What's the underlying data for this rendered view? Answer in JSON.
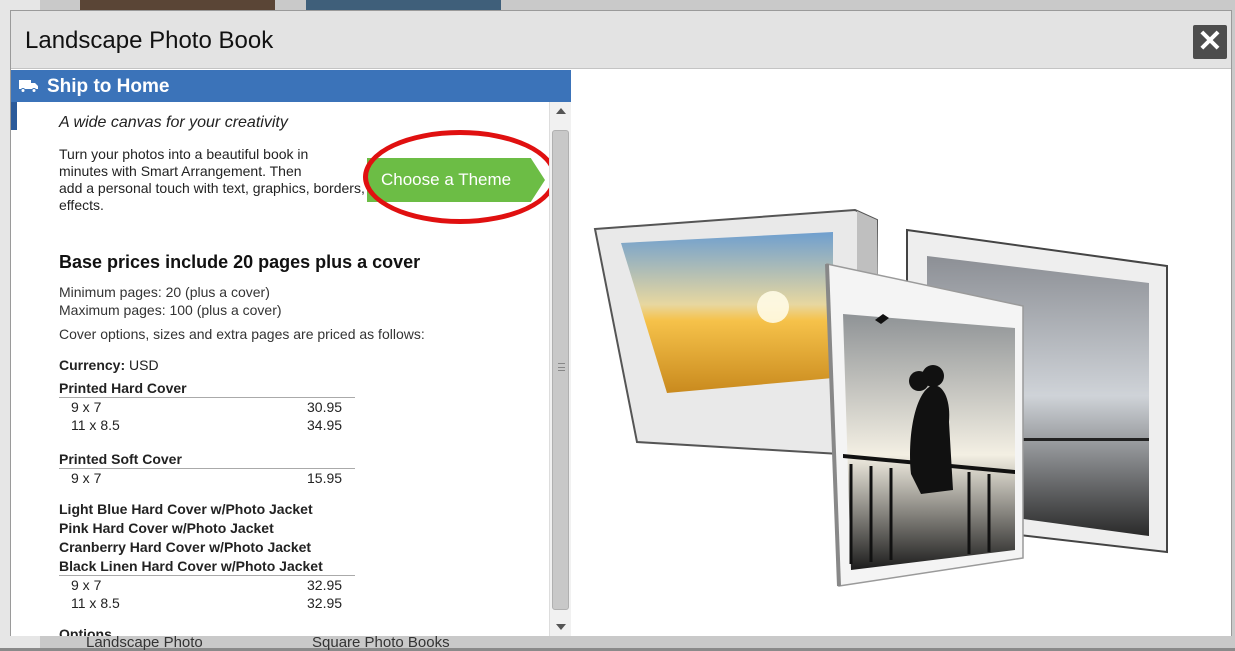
{
  "background": {
    "label_left": "Landscape Photo",
    "label_right": "Square Photo Books",
    "watermark": "book"
  },
  "dialog": {
    "title": "Landscape Photo Book",
    "close_icon": "close-icon"
  },
  "ship": {
    "icon": "truck-icon",
    "label": "Ship to Home"
  },
  "product": {
    "tagline": "A wide canvas for your creativity",
    "desc_line1": "Turn your photos into a beautiful book in",
    "desc_line2": "minutes with Smart Arrangement. Then",
    "desc_line3": "add a personal touch with text, graphics, borders, and tinting",
    "desc_line4": "effects.",
    "choose_theme": "Choose a Theme",
    "heading": "Base prices include 20 pages plus a cover",
    "min_pages": "Minimum pages: 20 (plus a cover)",
    "max_pages": "Maximum pages: 100 (plus a cover)",
    "cover_options": "Cover options, sizes and extra pages are priced as follows:",
    "currency_label": "Currency:",
    "currency_value": "USD",
    "groups": {
      "hard": {
        "title": "Printed Hard Cover",
        "rows": [
          {
            "size": "9 x 7",
            "price": "30.95"
          },
          {
            "size": "11 x 8.5",
            "price": "34.95"
          }
        ]
      },
      "soft": {
        "title": "Printed Soft Cover",
        "rows": [
          {
            "size": "9 x 7",
            "price": "15.95"
          }
        ]
      },
      "jacket": {
        "titles": [
          "Light Blue Hard Cover w/Photo Jacket",
          "Pink Hard Cover w/Photo Jacket",
          "Cranberry Hard Cover w/Photo Jacket",
          "Black Linen Hard Cover w/Photo Jacket"
        ],
        "rows": [
          {
            "size": "9 x 7",
            "price": "32.95"
          },
          {
            "size": "11 x 8.5",
            "price": "32.95"
          }
        ]
      }
    },
    "options_label": "Options"
  },
  "colors": {
    "ship_header": "#3b73b9",
    "choose_theme": "#6cbd45",
    "highlight_ring": "#e01010"
  }
}
